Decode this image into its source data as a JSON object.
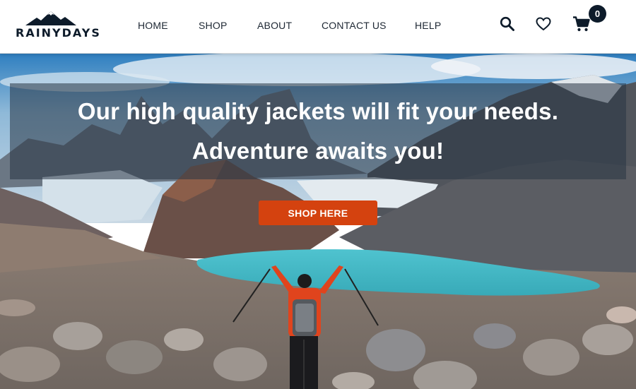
{
  "brand": {
    "name": "RAINYDAYS",
    "icon": "mountain-logo-icon",
    "color": "#0d1b2a"
  },
  "nav": {
    "items": [
      {
        "label": "HOME"
      },
      {
        "label": "SHOP"
      },
      {
        "label": "ABOUT"
      },
      {
        "label": "CONTACT US"
      },
      {
        "label": "HELP"
      }
    ]
  },
  "header_icons": {
    "search": "search-icon",
    "favorites": "heart-icon",
    "cart": "cart-icon",
    "cart_count": "0"
  },
  "hero": {
    "headline_line1": "Our high quality jackets will fit your needs.",
    "headline_line2": "Adventure awaits you!",
    "cta_label": "SHOP HERE",
    "cta_color": "#d4420f",
    "image": "hiker with raised trekking poles facing a turquoise mountain lake"
  }
}
